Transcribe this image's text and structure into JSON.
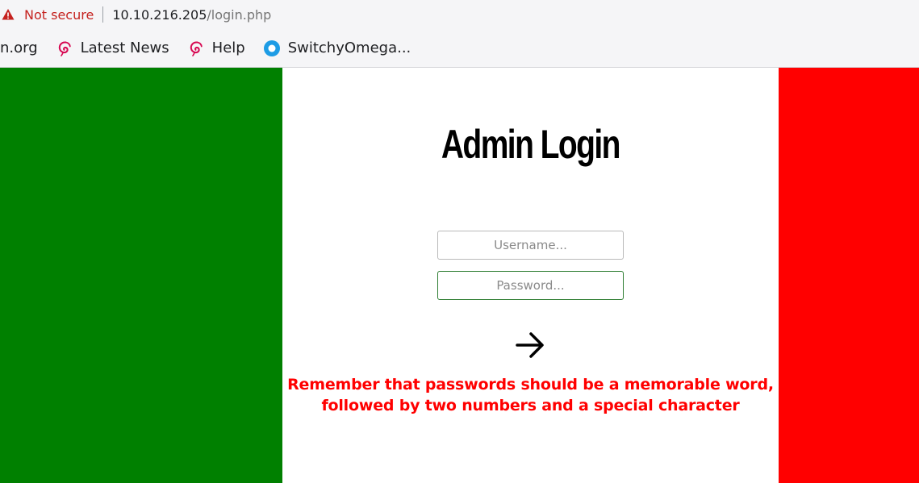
{
  "browser": {
    "security_label": "Not secure",
    "url_host": "10.10.216.205",
    "url_path": "/login.php",
    "bookmarks": [
      {
        "label": "n.org",
        "icon": "none"
      },
      {
        "label": "Latest News",
        "icon": "debian-swirl-icon"
      },
      {
        "label": "Help",
        "icon": "debian-swirl-icon"
      },
      {
        "label": "SwitchyOmega...",
        "icon": "switchyomega-icon"
      }
    ]
  },
  "colors": {
    "left_stripe": "#008000",
    "right_stripe": "#ff0000",
    "center": "#ffffff",
    "hint_text": "#ff0000"
  },
  "login": {
    "title": "Admin Login",
    "username_placeholder": "Username...",
    "password_placeholder": "Password...",
    "submit_icon": "arrow-right-icon",
    "hint": "Remember that passwords should be a memorable word, followed by two numbers and a special character"
  }
}
